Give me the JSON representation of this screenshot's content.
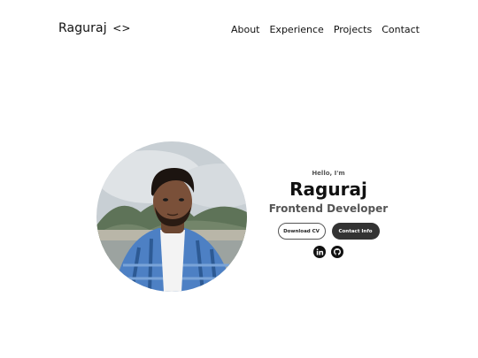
{
  "nav": {
    "logo": "Raguraj",
    "logo_code": "<>",
    "links": [
      "About",
      "Experience",
      "Projects",
      "Contact"
    ]
  },
  "hero": {
    "greeting": "Hello, I'm",
    "name": "Raguraj",
    "role": "Frontend Developer",
    "buttons": {
      "download_cv": "Download CV",
      "contact_info": "Contact Info"
    },
    "socials": [
      "linkedin-icon",
      "github-icon"
    ]
  },
  "colors": {
    "text": "#111111",
    "muted": "#555555",
    "button_dark": "#333333"
  }
}
